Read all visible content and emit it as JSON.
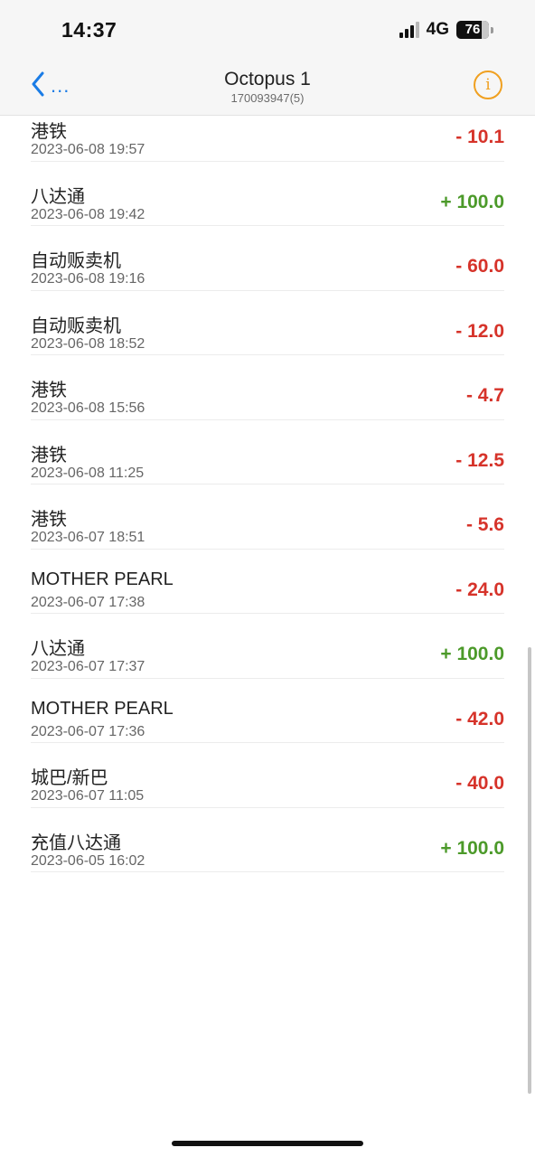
{
  "status_bar": {
    "time": "14:37",
    "network": "4G",
    "battery": "76"
  },
  "nav": {
    "back_label": "...",
    "title": "Octopus 1",
    "subtitle": "170093947(5)"
  },
  "transactions": [
    {
      "name": "港铁",
      "date": "2023-06-08 19:57",
      "amount": "- 10.1",
      "type": "debit"
    },
    {
      "name": "八达通",
      "date": "2023-06-08 19:42",
      "amount": "+ 100.0",
      "type": "credit"
    },
    {
      "name": "自动贩卖机",
      "date": "2023-06-08 19:16",
      "amount": "- 60.0",
      "type": "debit"
    },
    {
      "name": "自动贩卖机",
      "date": "2023-06-08 18:52",
      "amount": "- 12.0",
      "type": "debit"
    },
    {
      "name": "港铁",
      "date": "2023-06-08 15:56",
      "amount": "- 4.7",
      "type": "debit"
    },
    {
      "name": "港铁",
      "date": "2023-06-08 11:25",
      "amount": "- 12.5",
      "type": "debit"
    },
    {
      "name": "港铁",
      "date": "2023-06-07 18:51",
      "amount": "- 5.6",
      "type": "debit"
    },
    {
      "name": "MOTHER PEARL",
      "date": "2023-06-07 17:38",
      "amount": "- 24.0",
      "type": "debit"
    },
    {
      "name": "八达通",
      "date": "2023-06-07 17:37",
      "amount": "+ 100.0",
      "type": "credit"
    },
    {
      "name": "MOTHER PEARL",
      "date": "2023-06-07 17:36",
      "amount": "- 42.0",
      "type": "debit"
    },
    {
      "name": "城巴/新巴",
      "date": "2023-06-07 11:05",
      "amount": "- 40.0",
      "type": "debit"
    },
    {
      "name": "充值八达通",
      "date": "2023-06-05 16:02",
      "amount": "+ 100.0",
      "type": "credit"
    }
  ],
  "colors": {
    "accent": "#1a7ce6",
    "debit": "#d6332a",
    "credit": "#4c9a2a",
    "info": "#f0a020"
  },
  "icons": {
    "back": "chevron-left-icon",
    "info": "info-icon"
  }
}
